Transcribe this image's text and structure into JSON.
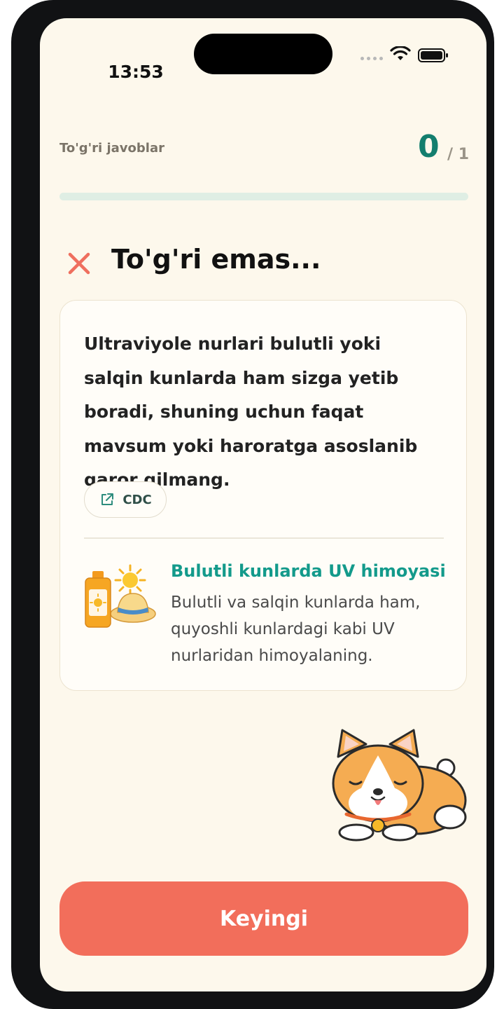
{
  "status_bar": {
    "time": "13:53"
  },
  "score": {
    "label": "To'g'ri javoblar",
    "correct": "0",
    "total": "/ 1",
    "progress": 0
  },
  "result": {
    "title": "To'g'ri emas..."
  },
  "explanation": {
    "text": "Ultraviyole nurlari bulutli yoki salqin kunlarda ham sizga yetib boradi, shuning uchun faqat mavsum yoki haroratga asoslanib qaror qilmang."
  },
  "source": {
    "label": "CDC"
  },
  "tip": {
    "title": "Bulutli kunlarda UV himoyasi",
    "body": "Bulutli va salqin kunlarda ham, quyoshli kunlardagi kabi UV nurlaridan himoyalaning."
  },
  "next_button": {
    "label": "Keyingi"
  },
  "colors": {
    "accent": "#137e6e",
    "error": "#f26e5b",
    "tip_title": "#139a8b",
    "background": "#fdf8ec"
  },
  "icons": [
    "wifi-icon",
    "battery-icon",
    "close-icon",
    "external-link-icon"
  ]
}
